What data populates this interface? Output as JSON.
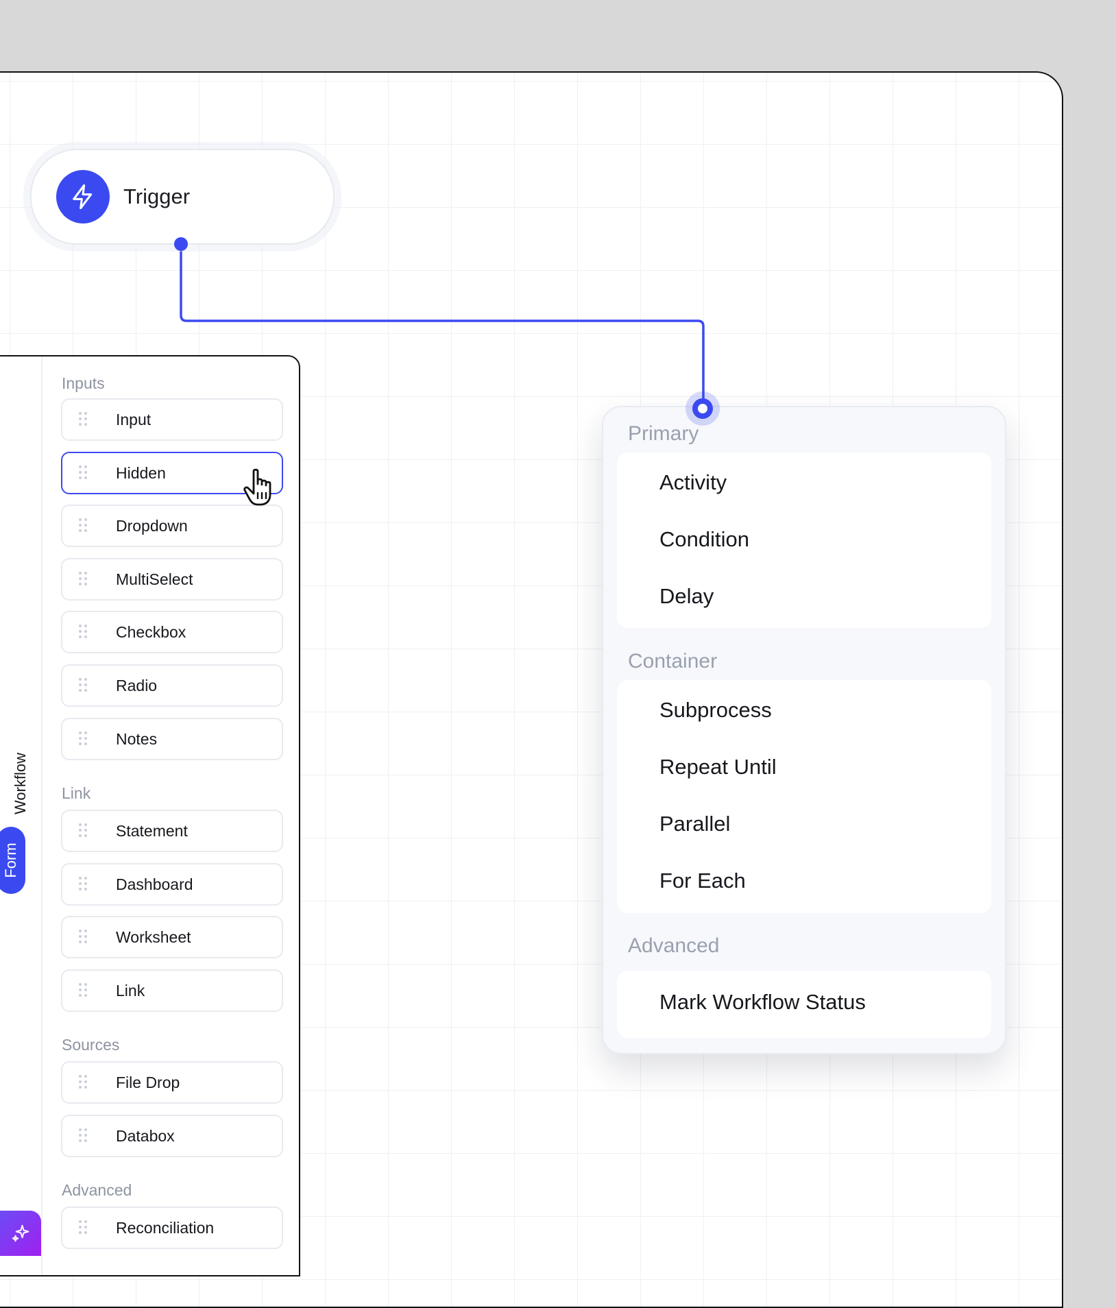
{
  "trigger": {
    "label": "Trigger",
    "icon": "lightning-icon"
  },
  "sidebar": {
    "tabs": [
      {
        "label": "Workflow",
        "active": false
      },
      {
        "label": "Form",
        "active": true
      }
    ],
    "groups": [
      {
        "title": "Inputs",
        "items": [
          "Input",
          "Hidden",
          "Dropdown",
          "MultiSelect",
          "Checkbox",
          "Radio",
          "Notes"
        ]
      },
      {
        "title": "Link",
        "items": [
          "Statement",
          "Dashboard",
          "Worksheet",
          "Link"
        ]
      },
      {
        "title": "Sources",
        "items": [
          "File Drop",
          "Databox"
        ]
      },
      {
        "title": "Advanced",
        "items": [
          "Reconciliation"
        ]
      }
    ],
    "hovered_item": "Hidden",
    "ai_button_icon": "sparkles-icon"
  },
  "node_menu": {
    "sections": [
      {
        "title": "Primary",
        "options": [
          "Activity",
          "Condition",
          "Delay"
        ]
      },
      {
        "title": "Container",
        "options": [
          "Subprocess",
          "Repeat Until",
          "Parallel",
          "For Each"
        ]
      },
      {
        "title": "Advanced",
        "options": [
          "Mark Workflow Status"
        ]
      }
    ]
  },
  "colors": {
    "accent": "#3b4af0",
    "ai_gradient_start": "#6d4cf5",
    "ai_gradient_end": "#a020f0"
  }
}
